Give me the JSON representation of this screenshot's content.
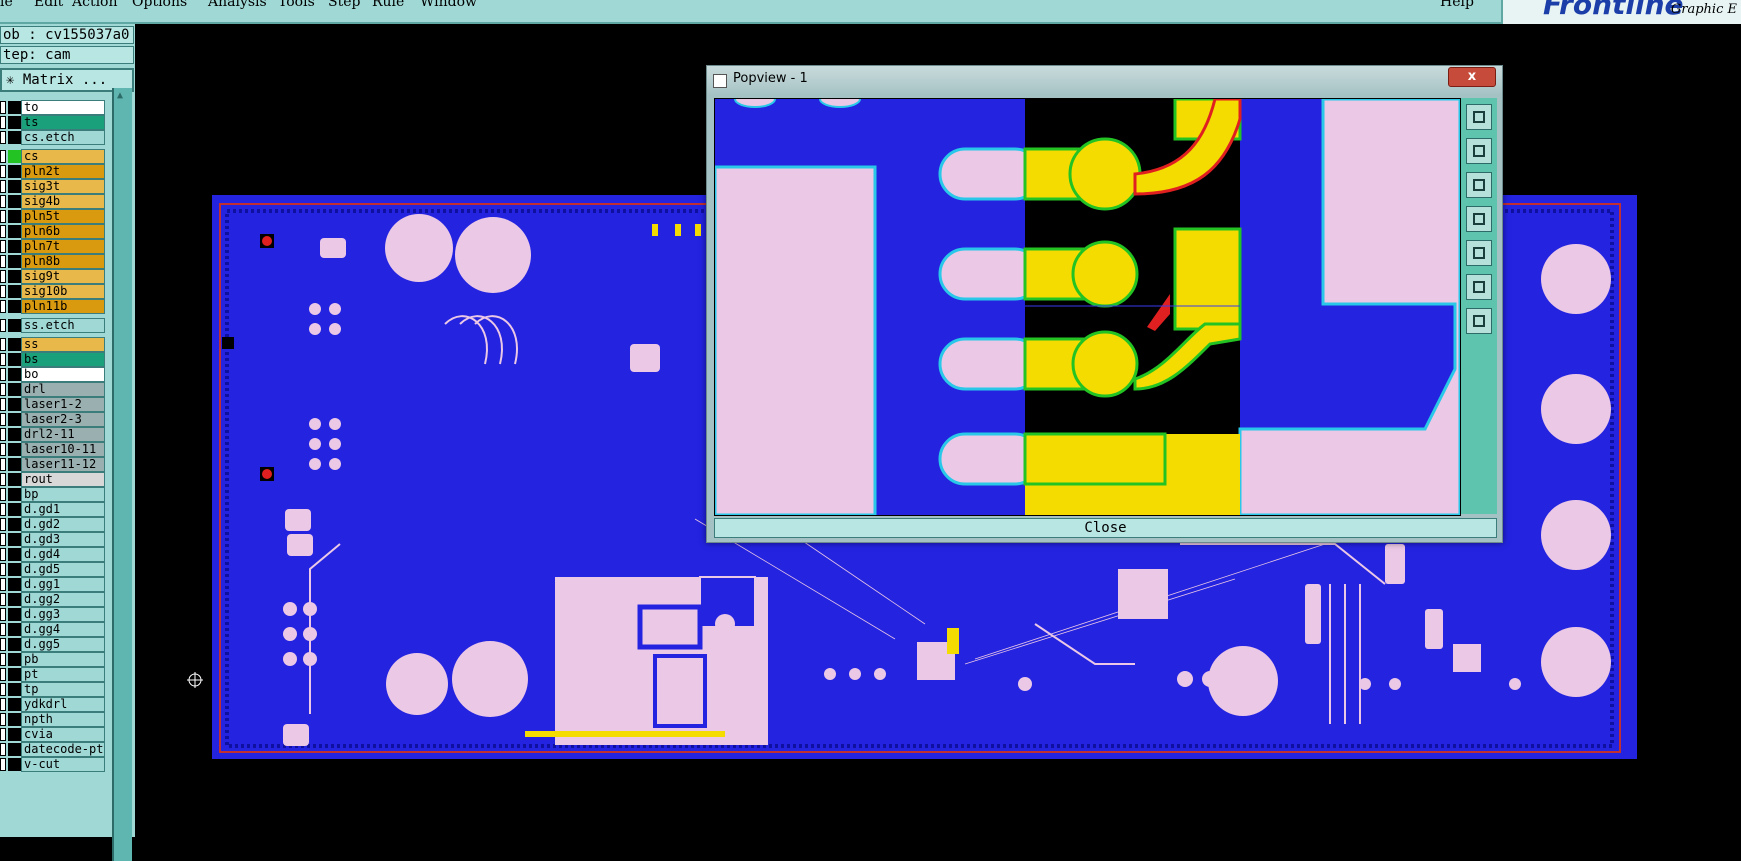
{
  "menubar": {
    "items": [
      "le",
      "Edit",
      "Action",
      "Options",
      "Analysis",
      "Tools",
      "Step",
      "Rule",
      "Window"
    ],
    "help": "Help",
    "brand_logo": "Frontline",
    "brand_sub": "Graphic E"
  },
  "left_panel": {
    "job": "ob : cv155037a0",
    "step": "tep: cam",
    "matrix_button": "Matrix ..."
  },
  "layers": [
    {
      "name": "to",
      "bg": "#ffffff"
    },
    {
      "name": "ts",
      "bg": "#1aa07a"
    },
    {
      "name": "cs.etch",
      "bg": "#9fd8d5"
    },
    {
      "name": "cs",
      "bg": "#e8b84a",
      "swatch": "#22c322"
    },
    {
      "name": "pln2t",
      "bg": "#d99a10"
    },
    {
      "name": "sig3t",
      "bg": "#e8b84a"
    },
    {
      "name": "sig4b",
      "bg": "#e8b84a"
    },
    {
      "name": "pln5t",
      "bg": "#d99a10"
    },
    {
      "name": "pln6b",
      "bg": "#d99a10"
    },
    {
      "name": "pln7t",
      "bg": "#d99a10"
    },
    {
      "name": "pln8b",
      "bg": "#d99a10"
    },
    {
      "name": "sig9t",
      "bg": "#e8b84a"
    },
    {
      "name": "sig10b",
      "bg": "#e8b84a"
    },
    {
      "name": "pln11b",
      "bg": "#d99a10"
    },
    {
      "name": "ss.etch",
      "bg": "#9fd8d5"
    },
    {
      "name": "ss",
      "bg": "#e8b84a"
    },
    {
      "name": "bs",
      "bg": "#1aa07a"
    },
    {
      "name": "bo",
      "bg": "#ffffff"
    },
    {
      "name": "drl",
      "bg": "#9ab0b0"
    },
    {
      "name": "laser1-2",
      "bg": "#9ab0b0"
    },
    {
      "name": "laser2-3",
      "bg": "#9ab0b0"
    },
    {
      "name": "drl2-11",
      "bg": "#9ab0b0"
    },
    {
      "name": "laser10-11",
      "bg": "#9ab0b0"
    },
    {
      "name": "laser11-12",
      "bg": "#9ab0b0"
    },
    {
      "name": "rout",
      "bg": "#d8d8d8"
    },
    {
      "name": "bp",
      "bg": "#9fd8d5"
    },
    {
      "name": "d.gd1",
      "bg": "#9fd8d5"
    },
    {
      "name": "d.gd2",
      "bg": "#9fd8d5"
    },
    {
      "name": "d.gd3",
      "bg": "#9fd8d5"
    },
    {
      "name": "d.gd4",
      "bg": "#9fd8d5"
    },
    {
      "name": "d.gd5",
      "bg": "#9fd8d5"
    },
    {
      "name": "d.gg1",
      "bg": "#9fd8d5"
    },
    {
      "name": "d.gg2",
      "bg": "#9fd8d5"
    },
    {
      "name": "d.gg3",
      "bg": "#9fd8d5"
    },
    {
      "name": "d.gg4",
      "bg": "#9fd8d5"
    },
    {
      "name": "d.gg5",
      "bg": "#9fd8d5"
    },
    {
      "name": "pb",
      "bg": "#9fd8d5"
    },
    {
      "name": "pt",
      "bg": "#9fd8d5"
    },
    {
      "name": "tp",
      "bg": "#9fd8d5"
    },
    {
      "name": "ydkdrl",
      "bg": "#9fd8d5"
    },
    {
      "name": "npth",
      "bg": "#9fd8d5"
    },
    {
      "name": "cvia",
      "bg": "#9fd8d5"
    },
    {
      "name": "datecode-pte",
      "bg": "#9fd8d5"
    },
    {
      "name": "v-cut",
      "bg": "#9fd8d5"
    }
  ],
  "popview": {
    "title": "Popview - 1",
    "close_x": "x",
    "close_button": "Close",
    "tools": [
      "zoom-home-icon",
      "layer-up-icon",
      "layer-down-icon",
      "pan-left-icon",
      "pan-right-icon",
      "fit-icon",
      "zoom-fit-icon"
    ]
  },
  "colors": {
    "board": "#2323e0",
    "copper": "#ebc8e6",
    "highlight": "#f5dc00",
    "panel": "#9fd8d5"
  }
}
